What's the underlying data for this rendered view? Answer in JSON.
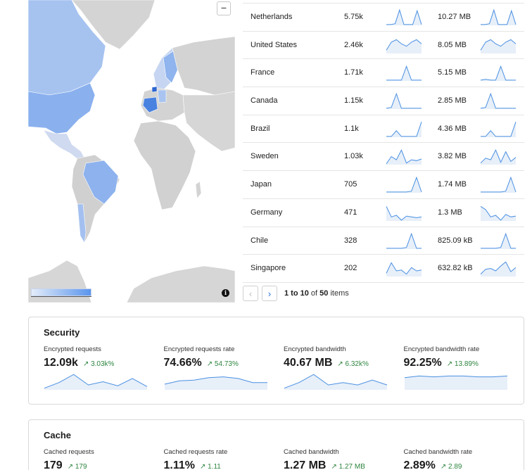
{
  "map": {
    "zoom_out_label": "−",
    "info_label": "i"
  },
  "countries": [
    {
      "name": "Netherlands",
      "requests": "5.75k",
      "bandwidth": "10.27 MB",
      "req_trend": [
        0.05,
        0.05,
        0.1,
        0.95,
        0.05,
        0.05,
        0.05,
        0.9,
        0.05
      ],
      "bw_trend": [
        0.05,
        0.05,
        0.1,
        0.95,
        0.05,
        0.05,
        0.05,
        0.9,
        0.05
      ]
    },
    {
      "name": "United States",
      "requests": "2.46k",
      "bandwidth": "8.05 MB",
      "req_trend": [
        0.2,
        0.7,
        0.85,
        0.6,
        0.45,
        0.7,
        0.85,
        0.6
      ],
      "bw_trend": [
        0.2,
        0.7,
        0.85,
        0.6,
        0.45,
        0.7,
        0.85,
        0.6
      ]
    },
    {
      "name": "France",
      "requests": "1.71k",
      "bandwidth": "5.15 MB",
      "req_trend": [
        0.05,
        0.05,
        0.05,
        0.05,
        0.9,
        0.05,
        0.05,
        0.05
      ],
      "bw_trend": [
        0.05,
        0.1,
        0.05,
        0.05,
        0.9,
        0.05,
        0.05,
        0.05
      ]
    },
    {
      "name": "Canada",
      "requests": "1.15k",
      "bandwidth": "2.85 MB",
      "req_trend": [
        0.05,
        0.1,
        0.95,
        0.05,
        0.05,
        0.05,
        0.05,
        0.05
      ],
      "bw_trend": [
        0.05,
        0.1,
        0.95,
        0.05,
        0.05,
        0.05,
        0.05,
        0.05
      ]
    },
    {
      "name": "Brazil",
      "requests": "1.1k",
      "bandwidth": "4.36 MB",
      "req_trend": [
        0.05,
        0.05,
        0.4,
        0.05,
        0.05,
        0.05,
        0.05,
        0.95
      ],
      "bw_trend": [
        0.05,
        0.05,
        0.4,
        0.05,
        0.05,
        0.05,
        0.05,
        0.95
      ]
    },
    {
      "name": "Sweden",
      "requests": "1.03k",
      "bandwidth": "3.82 MB",
      "req_trend": [
        0.05,
        0.5,
        0.3,
        0.9,
        0.1,
        0.3,
        0.25,
        0.35
      ],
      "bw_trend": [
        0.1,
        0.4,
        0.3,
        0.9,
        0.15,
        0.8,
        0.2,
        0.45
      ]
    },
    {
      "name": "Japan",
      "requests": "705",
      "bandwidth": "1.74 MB",
      "req_trend": [
        0.05,
        0.05,
        0.05,
        0.05,
        0.05,
        0.1,
        0.95,
        0.05
      ],
      "bw_trend": [
        0.05,
        0.05,
        0.05,
        0.05,
        0.05,
        0.1,
        0.95,
        0.05
      ]
    },
    {
      "name": "Germany",
      "requests": "471",
      "bandwidth": "1.3 MB",
      "req_trend": [
        0.9,
        0.25,
        0.35,
        0.05,
        0.3,
        0.25,
        0.2,
        0.25
      ],
      "bw_trend": [
        0.9,
        0.7,
        0.25,
        0.35,
        0.05,
        0.4,
        0.25,
        0.3
      ]
    },
    {
      "name": "Chile",
      "requests": "328",
      "bandwidth": "825.09 kB",
      "req_trend": [
        0.05,
        0.05,
        0.05,
        0.05,
        0.1,
        0.95,
        0.05,
        0.05
      ],
      "bw_trend": [
        0.05,
        0.05,
        0.05,
        0.05,
        0.1,
        0.95,
        0.05,
        0.05
      ]
    },
    {
      "name": "Singapore",
      "requests": "202",
      "bandwidth": "632.82 kB",
      "req_trend": [
        0.2,
        0.85,
        0.35,
        0.4,
        0.15,
        0.55,
        0.35,
        0.4
      ],
      "bw_trend": [
        0.15,
        0.45,
        0.5,
        0.35,
        0.65,
        0.9,
        0.3,
        0.55
      ]
    }
  ],
  "pagination": {
    "prev_label": "‹",
    "next_label": "›",
    "range": "1 to 10",
    "of_word": "of",
    "total": "50",
    "items_word": "items"
  },
  "security": {
    "title": "Security",
    "metrics": [
      {
        "label": "Encrypted requests",
        "value": "12.09k",
        "delta": "↗ 3.03k%",
        "trend": [
          0.1,
          0.45,
          0.95,
          0.3,
          0.5,
          0.25,
          0.7,
          0.2
        ]
      },
      {
        "label": "Encrypted requests rate",
        "value": "74.66%",
        "delta": "↗ 54.73%",
        "trend": [
          0.35,
          0.55,
          0.6,
          0.75,
          0.8,
          0.7,
          0.45,
          0.45
        ]
      },
      {
        "label": "Encrypted bandwidth",
        "value": "40.67 MB",
        "delta": "↗ 6.32k%",
        "trend": [
          0.1,
          0.45,
          0.95,
          0.3,
          0.45,
          0.3,
          0.6,
          0.3
        ]
      },
      {
        "label": "Encrypted bandwidth rate",
        "value": "92.25%",
        "delta": "↗ 13.89%",
        "trend": [
          0.75,
          0.85,
          0.8,
          0.85,
          0.85,
          0.8,
          0.8,
          0.85
        ]
      }
    ]
  },
  "cache": {
    "title": "Cache",
    "metrics": [
      {
        "label": "Cached requests",
        "value": "179",
        "delta": "↗ 179"
      },
      {
        "label": "Cached requests rate",
        "value": "1.11%",
        "delta": "↗ 1.11"
      },
      {
        "label": "Cached bandwidth",
        "value": "1.27 MB",
        "delta": "↗ 1.27 MB"
      },
      {
        "label": "Cached bandwidth rate",
        "value": "2.89%",
        "delta": "↗ 2.89"
      }
    ]
  },
  "colors": {
    "spark_line": "#4a90e2",
    "spark_fill": "#dde8f7",
    "delta_green": "#2e8540",
    "map_land": "#d3d3d3",
    "map_highlight": "#8fb4ee",
    "map_strong": "#4a82e0"
  }
}
